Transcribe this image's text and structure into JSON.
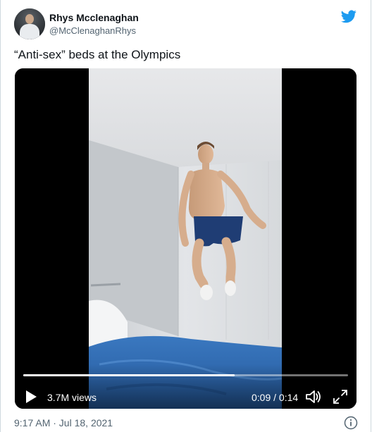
{
  "author": {
    "name": "Rhys Mcclenaghan",
    "handle": "@McClenaghanRhys"
  },
  "tweet": {
    "text": "“Anti-sex” beds at the Olympics"
  },
  "video": {
    "views": "3.7M views",
    "time": "0:09 / 0:14",
    "progress": 0.65
  },
  "footer": {
    "timestamp": "9:17 AM · Jul 18, 2021"
  },
  "icons": {
    "brand": "twitter-bird-icon",
    "play": "play-icon",
    "volume": "volume-icon",
    "fullscreen": "fullscreen-icon",
    "info": "info-icon"
  },
  "colors": {
    "twitter_blue": "#1d9bf0",
    "text_primary": "#0f1419",
    "text_secondary": "#536471",
    "bed_blue": "#2f6cb3"
  }
}
